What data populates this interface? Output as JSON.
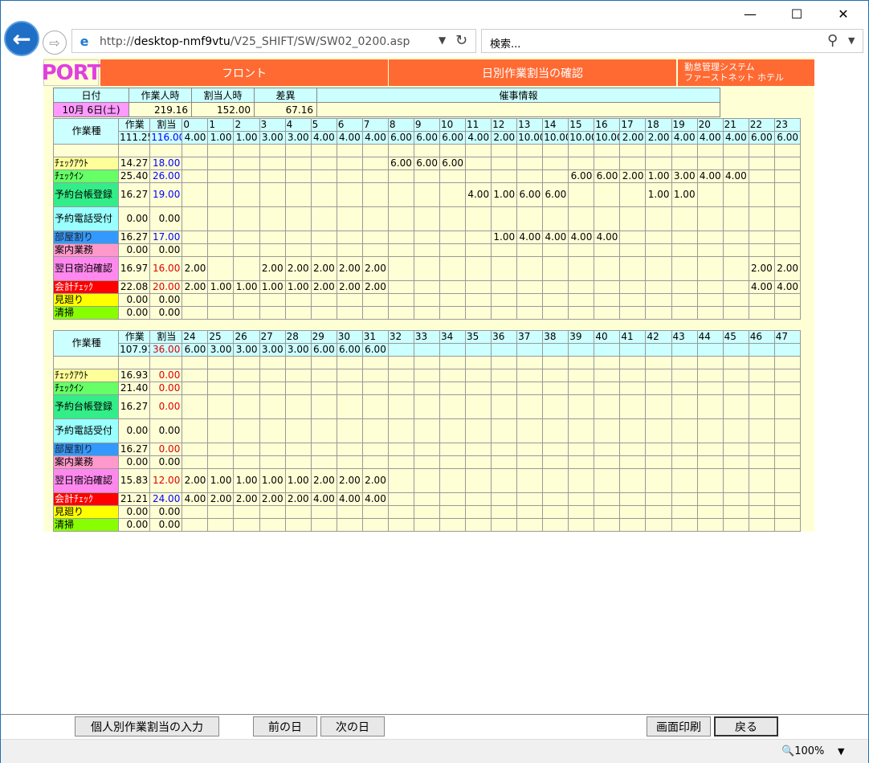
{
  "browser": {
    "url_prefix": "http://",
    "url_host": "desktop-nmf9vtu",
    "url_path": "/V25_SHIFT/SW/SW02_0200.asp",
    "search_placeholder": "検索...",
    "zoom": "100%"
  },
  "header": {
    "logo": "PORT",
    "dept": "フロント",
    "title": "日別作業割当の確認",
    "system_line1": "勤怠管理システム",
    "system_line2": "ファーストネット ホテル"
  },
  "summary": {
    "date_label": "日付",
    "work_label": "作業人時",
    "assign_label": "割当人時",
    "diff_label": "差異",
    "event_label": "催事情報",
    "date": "10月 6日(土)",
    "work": "219.16",
    "assign": "152.00",
    "diff": "67.16"
  },
  "table_labels": {
    "job": "作業種",
    "work": "作業",
    "assign": "割当"
  },
  "grids": [
    {
      "hours": [
        "0",
        "1",
        "2",
        "3",
        "4",
        "5",
        "6",
        "7",
        "8",
        "9",
        "10",
        "11",
        "12",
        "13",
        "14",
        "15",
        "16",
        "17",
        "18",
        "19",
        "20",
        "21",
        "22",
        "23"
      ],
      "total_work": "111.25",
      "total_assign": "116.00",
      "total_assign_color": "blue",
      "hour_totals": [
        "4.00",
        "1.00",
        "1.00",
        "3.00",
        "3.00",
        "4.00",
        "4.00",
        "4.00",
        "6.00",
        "6.00",
        "6.00",
        "4.00",
        "2.00",
        "10.00",
        "10.00",
        "10.00",
        "10.00",
        "2.00",
        "2.00",
        "4.00",
        "4.00",
        "4.00",
        "6.00",
        "6.00"
      ],
      "rows": [
        {
          "name": "ﾁｪｯｸｱｳﾄ",
          "color": "#ffff99",
          "work": "14.27",
          "assign": "18.00",
          "assign_color": "blue",
          "cells": [
            "",
            "",
            "",
            "",
            "",
            "",
            "",
            "",
            "6.00",
            "6.00",
            "6.00",
            "",
            "",
            "",
            "",
            "",
            "",
            "",
            "",
            "",
            "",
            "",
            "",
            ""
          ]
        },
        {
          "name": "ﾁｪｯｸｲﾝ",
          "color": "#66ff66",
          "work": "25.40",
          "assign": "26.00",
          "assign_color": "blue",
          "cells": [
            "",
            "",
            "",
            "",
            "",
            "",
            "",
            "",
            "",
            "",
            "",
            "",
            "",
            "",
            "",
            "6.00",
            "6.00",
            "2.00",
            "1.00",
            "3.00",
            "4.00",
            "4.00",
            "",
            ""
          ]
        },
        {
          "name": "予約台帳登録",
          "color": "#33ee88",
          "work": "16.27",
          "assign": "19.00",
          "assign_color": "blue",
          "tall": true,
          "cells": [
            "",
            "",
            "",
            "",
            "",
            "",
            "",
            "",
            "",
            "",
            "",
            "4.00",
            "1.00",
            "6.00",
            "6.00",
            "",
            "",
            "",
            "1.00",
            "1.00",
            "",
            "",
            "",
            ""
          ]
        },
        {
          "name": "予約電話受付",
          "color": "#99ffff",
          "work": "0.00",
          "assign": "0.00",
          "assign_color": "",
          "tall": true,
          "cells": [
            "",
            "",
            "",
            "",
            "",
            "",
            "",
            "",
            "",
            "",
            "",
            "",
            "",
            "",
            "",
            "",
            "",
            "",
            "",
            "",
            "",
            "",
            "",
            ""
          ]
        },
        {
          "name": "部屋割り",
          "color": "#3399ff",
          "work": "16.27",
          "assign": "17.00",
          "assign_color": "blue",
          "cells": [
            "",
            "",
            "",
            "",
            "",
            "",
            "",
            "",
            "",
            "",
            "",
            "",
            "1.00",
            "4.00",
            "4.00",
            "4.00",
            "4.00",
            "",
            "",
            "",
            "",
            "",
            "",
            ""
          ]
        },
        {
          "name": "案内業務",
          "color": "#ff99cc",
          "work": "0.00",
          "assign": "0.00",
          "assign_color": "",
          "cells": [
            "",
            "",
            "",
            "",
            "",
            "",
            "",
            "",
            "",
            "",
            "",
            "",
            "",
            "",
            "",
            "",
            "",
            "",
            "",
            "",
            "",
            "",
            "",
            ""
          ]
        },
        {
          "name": "翌日宿泊確認",
          "color": "#ff88ee",
          "work": "16.97",
          "assign": "16.00",
          "assign_color": "red",
          "tall": true,
          "cells": [
            "2.00",
            "",
            "",
            "2.00",
            "2.00",
            "2.00",
            "2.00",
            "2.00",
            "",
            "",
            "",
            "",
            "",
            "",
            "",
            "",
            "",
            "",
            "",
            "",
            "",
            "",
            "2.00",
            "2.00"
          ]
        },
        {
          "name": "会計ﾁｪｯｸ",
          "color": "#ff0000",
          "work": "22.08",
          "assign": "20.00",
          "assign_color": "red",
          "cells": [
            "2.00",
            "1.00",
            "1.00",
            "1.00",
            "1.00",
            "2.00",
            "2.00",
            "2.00",
            "",
            "",
            "",
            "",
            "",
            "",
            "",
            "",
            "",
            "",
            "",
            "",
            "",
            "",
            "4.00",
            "4.00"
          ]
        },
        {
          "name": "見廻り",
          "color": "#ffff00",
          "work": "0.00",
          "assign": "0.00",
          "assign_color": "",
          "cells": [
            "",
            "",
            "",
            "",
            "",
            "",
            "",
            "",
            "",
            "",
            "",
            "",
            "",
            "",
            "",
            "",
            "",
            "",
            "",
            "",
            "",
            "",
            "",
            ""
          ]
        },
        {
          "name": "清掃",
          "color": "#88ff00",
          "work": "0.00",
          "assign": "0.00",
          "assign_color": "",
          "cells": [
            "",
            "",
            "",
            "",
            "",
            "",
            "",
            "",
            "",
            "",
            "",
            "",
            "",
            "",
            "",
            "",
            "",
            "",
            "",
            "",
            "",
            "",
            "",
            ""
          ]
        }
      ]
    },
    {
      "hours": [
        "24",
        "25",
        "26",
        "27",
        "28",
        "29",
        "30",
        "31",
        "32",
        "33",
        "34",
        "35",
        "36",
        "37",
        "38",
        "39",
        "40",
        "41",
        "42",
        "43",
        "44",
        "45",
        "46",
        "47"
      ],
      "total_work": "107.91",
      "total_assign": "36.00",
      "total_assign_color": "red",
      "hour_totals": [
        "6.00",
        "3.00",
        "3.00",
        "3.00",
        "3.00",
        "6.00",
        "6.00",
        "6.00",
        "",
        "",
        "",
        "",
        "",
        "",
        "",
        "",
        "",
        "",
        "",
        "",
        "",
        "",
        "",
        ""
      ],
      "rows": [
        {
          "name": "ﾁｪｯｸｱｳﾄ",
          "color": "#ffff99",
          "work": "16.93",
          "assign": "0.00",
          "assign_color": "red",
          "cells": [
            "",
            "",
            "",
            "",
            "",
            "",
            "",
            "",
            "",
            "",
            "",
            "",
            "",
            "",
            "",
            "",
            "",
            "",
            "",
            "",
            "",
            "",
            "",
            ""
          ]
        },
        {
          "name": "ﾁｪｯｸｲﾝ",
          "color": "#66ff66",
          "work": "21.40",
          "assign": "0.00",
          "assign_color": "red",
          "cells": [
            "",
            "",
            "",
            "",
            "",
            "",
            "",
            "",
            "",
            "",
            "",
            "",
            "",
            "",
            "",
            "",
            "",
            "",
            "",
            "",
            "",
            "",
            "",
            ""
          ]
        },
        {
          "name": "予約台帳登録",
          "color": "#33ee88",
          "work": "16.27",
          "assign": "0.00",
          "assign_color": "red",
          "tall": true,
          "cells": [
            "",
            "",
            "",
            "",
            "",
            "",
            "",
            "",
            "",
            "",
            "",
            "",
            "",
            "",
            "",
            "",
            "",
            "",
            "",
            "",
            "",
            "",
            "",
            ""
          ]
        },
        {
          "name": "予約電話受付",
          "color": "#99ffff",
          "work": "0.00",
          "assign": "0.00",
          "assign_color": "",
          "tall": true,
          "cells": [
            "",
            "",
            "",
            "",
            "",
            "",
            "",
            "",
            "",
            "",
            "",
            "",
            "",
            "",
            "",
            "",
            "",
            "",
            "",
            "",
            "",
            "",
            "",
            ""
          ]
        },
        {
          "name": "部屋割り",
          "color": "#3399ff",
          "work": "16.27",
          "assign": "0.00",
          "assign_color": "red",
          "cells": [
            "",
            "",
            "",
            "",
            "",
            "",
            "",
            "",
            "",
            "",
            "",
            "",
            "",
            "",
            "",
            "",
            "",
            "",
            "",
            "",
            "",
            "",
            "",
            ""
          ]
        },
        {
          "name": "案内業務",
          "color": "#ff99cc",
          "work": "0.00",
          "assign": "0.00",
          "assign_color": "",
          "cells": [
            "",
            "",
            "",
            "",
            "",
            "",
            "",
            "",
            "",
            "",
            "",
            "",
            "",
            "",
            "",
            "",
            "",
            "",
            "",
            "",
            "",
            "",
            "",
            ""
          ]
        },
        {
          "name": "翌日宿泊確認",
          "color": "#ff88ee",
          "work": "15.83",
          "assign": "12.00",
          "assign_color": "red",
          "tall": true,
          "cells": [
            "2.00",
            "1.00",
            "1.00",
            "1.00",
            "1.00",
            "2.00",
            "2.00",
            "2.00",
            "",
            "",
            "",
            "",
            "",
            "",
            "",
            "",
            "",
            "",
            "",
            "",
            "",
            "",
            "",
            ""
          ]
        },
        {
          "name": "会計ﾁｪｯｸ",
          "color": "#ff0000",
          "work": "21.21",
          "assign": "24.00",
          "assign_color": "blue",
          "cells": [
            "4.00",
            "2.00",
            "2.00",
            "2.00",
            "2.00",
            "4.00",
            "4.00",
            "4.00",
            "",
            "",
            "",
            "",
            "",
            "",
            "",
            "",
            "",
            "",
            "",
            "",
            "",
            "",
            "",
            ""
          ]
        },
        {
          "name": "見廻り",
          "color": "#ffff00",
          "work": "0.00",
          "assign": "0.00",
          "assign_color": "",
          "cells": [
            "",
            "",
            "",
            "",
            "",
            "",
            "",
            "",
            "",
            "",
            "",
            "",
            "",
            "",
            "",
            "",
            "",
            "",
            "",
            "",
            "",
            "",
            "",
            ""
          ]
        },
        {
          "name": "清掃",
          "color": "#88ff00",
          "work": "0.00",
          "assign": "0.00",
          "assign_color": "",
          "cells": [
            "",
            "",
            "",
            "",
            "",
            "",
            "",
            "",
            "",
            "",
            "",
            "",
            "",
            "",
            "",
            "",
            "",
            "",
            "",
            "",
            "",
            "",
            "",
            ""
          ]
        }
      ]
    }
  ],
  "footer": {
    "individual": "個人別作業割当の入力",
    "prev": "前の日",
    "next": "次の日",
    "print": "画面印刷",
    "back": "戻る"
  }
}
